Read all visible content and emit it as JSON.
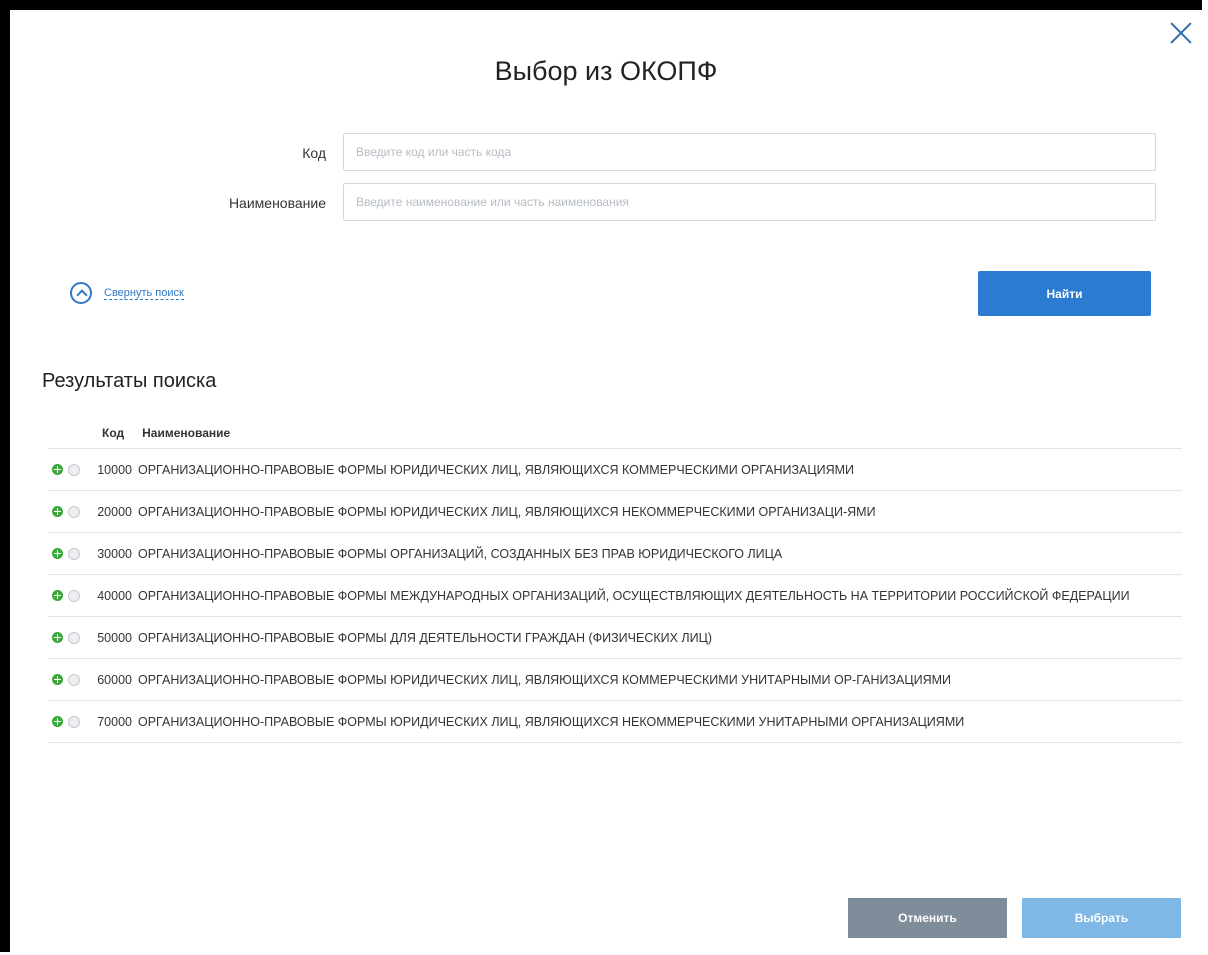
{
  "dialog": {
    "title": "Выбор из ОКОПФ",
    "close_icon": "close-icon"
  },
  "search": {
    "code_label": "Код",
    "code_placeholder": "Введите код или часть кода",
    "code_value": "",
    "name_label": "Наименование",
    "name_placeholder": "Введите наименование или часть наименования",
    "name_value": "",
    "collapse_label": "Свернуть поиск",
    "find_label": "Найти"
  },
  "results": {
    "title": "Результаты поиска",
    "columns": {
      "code": "Код",
      "name": "Наименование"
    },
    "rows": [
      {
        "code": "10000",
        "name": "ОРГАНИЗАЦИОННО-ПРАВОВЫЕ ФОРМЫ ЮРИДИЧЕСКИХ ЛИЦ, ЯВЛЯЮЩИХСЯ КОММЕРЧЕСКИМИ ОРГАНИЗАЦИЯМИ"
      },
      {
        "code": "20000",
        "name": "ОРГАНИЗАЦИОННО-ПРАВОВЫЕ ФОРМЫ ЮРИДИЧЕСКИХ ЛИЦ, ЯВЛЯЮЩИХСЯ НЕКОММЕРЧЕСКИМИ ОРГАНИЗАЦИ-ЯМИ"
      },
      {
        "code": "30000",
        "name": "ОРГАНИЗАЦИОННО-ПРАВОВЫЕ ФОРМЫ ОРГАНИЗАЦИЙ, СОЗДАННЫХ БЕЗ ПРАВ ЮРИДИЧЕСКОГО ЛИЦА"
      },
      {
        "code": "40000",
        "name": "ОРГАНИЗАЦИОННО-ПРАВОВЫЕ ФОРМЫ МЕЖДУНАРОДНЫХ ОРГАНИЗАЦИЙ, ОСУЩЕСТВЛЯЮЩИХ ДЕЯТЕЛЬНОСТЬ НА ТЕРРИТОРИИ РОССИЙСКОЙ ФЕДЕРАЦИИ"
      },
      {
        "code": "50000",
        "name": "ОРГАНИЗАЦИОННО-ПРАВОВЫЕ ФОРМЫ ДЛЯ ДЕЯТЕЛЬНОСТИ ГРАЖДАН (ФИЗИЧЕСКИХ ЛИЦ)"
      },
      {
        "code": "60000",
        "name": "ОРГАНИЗАЦИОННО-ПРАВОВЫЕ ФОРМЫ ЮРИДИЧЕСКИХ ЛИЦ, ЯВЛЯЮЩИХСЯ КОММЕРЧЕСКИМИ УНИТАРНЫМИ ОР-ГАНИЗАЦИЯМИ"
      },
      {
        "code": "70000",
        "name": "ОРГАНИЗАЦИОННО-ПРАВОВЫЕ ФОРМЫ ЮРИДИЧЕСКИХ ЛИЦ, ЯВЛЯЮЩИХСЯ НЕКОММЕРЧЕСКИМИ УНИТАРНЫМИ ОРГАНИЗАЦИЯМИ"
      }
    ]
  },
  "footer": {
    "cancel_label": "Отменить",
    "choose_label": "Выбрать"
  },
  "colors": {
    "primary": "#2b7bd1",
    "disabled_primary": "#7fb7e7",
    "secondary": "#7f8c9a",
    "expand_icon": "#3aa83a"
  }
}
